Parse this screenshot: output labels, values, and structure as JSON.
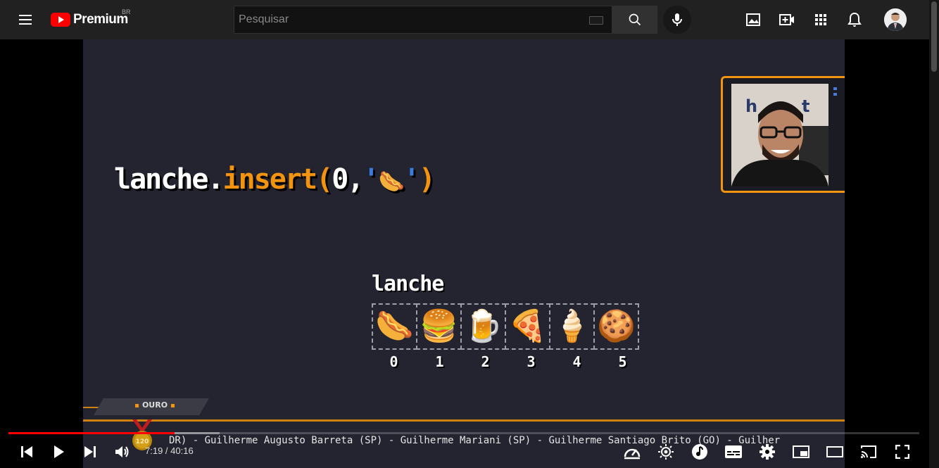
{
  "header": {
    "logo_text": "Premium",
    "logo_region": "BR",
    "search_placeholder": "Pesquisar",
    "icons": [
      "menu-icon",
      "search-icon",
      "mic-icon",
      "create-icon",
      "video-add-icon",
      "apps-icon",
      "notifications-icon"
    ]
  },
  "video": {
    "code": {
      "object": "lanche",
      "dot": ".",
      "method": "insert",
      "open": "(",
      "arg": "0,",
      "quote_open": "'",
      "item": "🌭",
      "quote_close": "'",
      "close": ")"
    },
    "array_label": "lanche",
    "array_items": [
      "🌭",
      "🍔",
      "🍺",
      "🍕",
      "🍦",
      "🍪"
    ],
    "array_indices": [
      "0",
      "1",
      "2",
      "3",
      "4",
      "5"
    ],
    "rank_label": "OURO",
    "medal_number": "120",
    "ticker_text": "DR) - Guilherme Augusto Barreta (SP) - Guilherme Mariani (SP) - Guilherme Santiago Brito (GO) - Guilher",
    "webcam_logo_text": "hc    t"
  },
  "player": {
    "current_time": "7:19",
    "separator": " / ",
    "duration": "40:16",
    "progress_fraction": 0.182,
    "buffered_fraction": 0.232,
    "colors": {
      "accent": "#ff0000",
      "code_orange": "#f2940f",
      "background": "#232430"
    }
  }
}
